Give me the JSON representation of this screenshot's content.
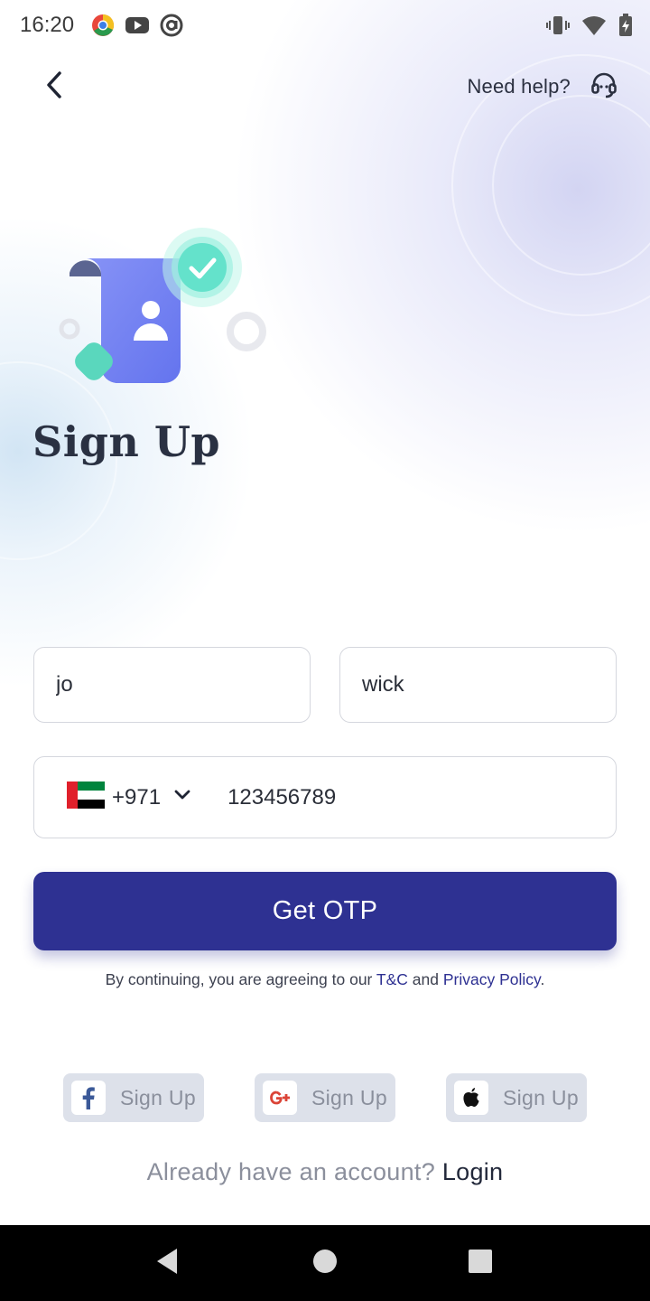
{
  "status_bar": {
    "time": "16:20",
    "app_icons": [
      "chrome-icon",
      "youtube-icon",
      "at-sign-icon"
    ],
    "system_icons": [
      "vibrate-icon",
      "wifi-icon",
      "battery-charging-icon"
    ]
  },
  "header": {
    "back_icon": "chevron-left-icon",
    "help_label": "Need help?",
    "help_icon": "headset-icon"
  },
  "page": {
    "title": "Sign Up",
    "illustration": "user-profile-check-illustration"
  },
  "form": {
    "first_name_value": "jo",
    "last_name_value": "wick",
    "country_flag": "uae-flag-icon",
    "country_code": "+971",
    "phone_value": "123456789",
    "submit_label": "Get OTP"
  },
  "terms": {
    "prefix": "By continuing, you are agreeing to our ",
    "tc_link": "T&C",
    "conjunction": " and ",
    "privacy_link": "Privacy Policy",
    "suffix": "."
  },
  "social": {
    "facebook_label": "Sign Up",
    "google_label": "Sign Up",
    "apple_label": "Sign Up"
  },
  "footer": {
    "prompt": "Already have an account? ",
    "login_label": "Login"
  },
  "colors": {
    "primary": "#2e3192",
    "facebook": "#3b5998",
    "google": "#db4437",
    "accent_teal": "#5fe0cc",
    "card_purple": "#6d79f0"
  }
}
